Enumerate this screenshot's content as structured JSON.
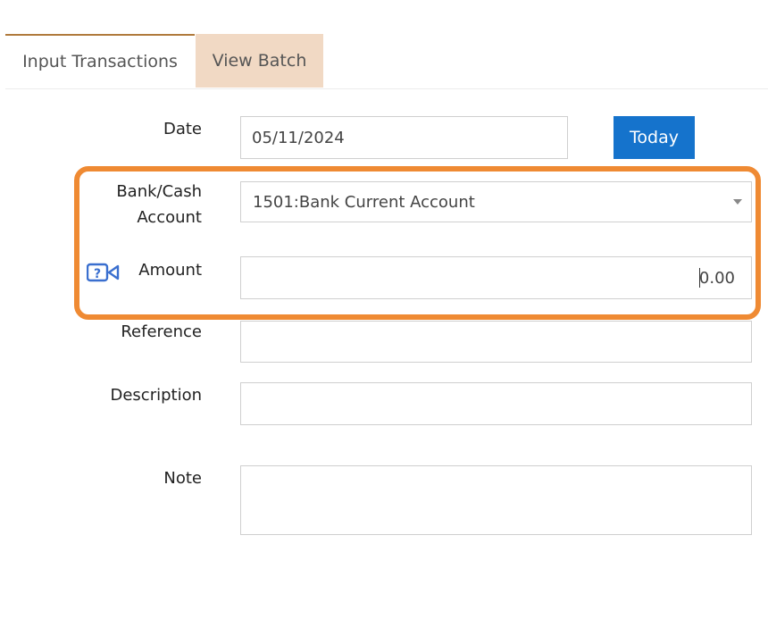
{
  "tabs": [
    {
      "label": "Input Transactions",
      "active": true
    },
    {
      "label": "View Batch",
      "active": false
    }
  ],
  "form": {
    "date": {
      "label": "Date",
      "value": "05/11/2024"
    },
    "today_button": "Today",
    "bank_account": {
      "label_line1": "Bank/Cash",
      "label_line2": "Account",
      "selected": "1501:Bank Current Account"
    },
    "amount": {
      "label": "Amount",
      "value": "0.00"
    },
    "reference": {
      "label": "Reference",
      "value": ""
    },
    "description": {
      "label": "Description",
      "value": ""
    },
    "note": {
      "label": "Note",
      "value": ""
    }
  },
  "icons": {
    "help_video": "help-video-icon",
    "dropdown": "chevron-down-icon"
  },
  "colors": {
    "primary_button": "#1573cc",
    "inactive_tab": "#f1d9c4",
    "active_tab_border": "#b07a3c",
    "highlight": "#ef8a33",
    "help_icon": "#3a6fcf"
  }
}
